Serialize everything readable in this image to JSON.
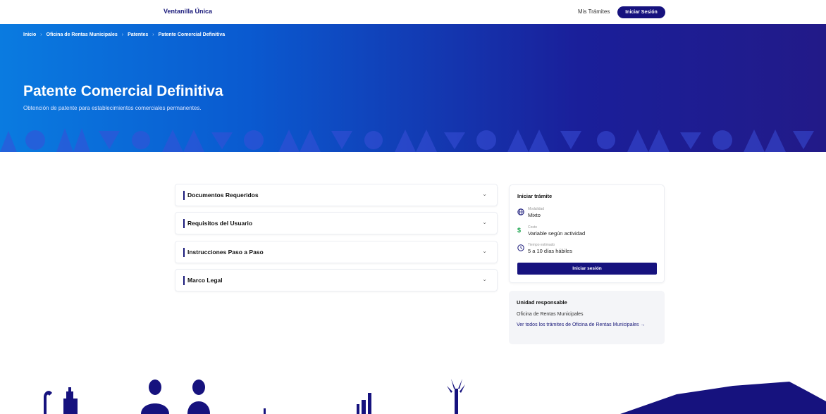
{
  "nav": {
    "brand": "Ventanilla Única",
    "my_procedures": "Mis Trámites",
    "login": "Iniciar Sesión"
  },
  "breadcrumb": [
    "Inicio",
    "Oficina de Rentas Municipales",
    "Patentes",
    "Patente Comercial Definitiva"
  ],
  "hero": {
    "title": "Patente Comercial Definitiva",
    "subtitle": "Obtención de patente para establecimientos comerciales permanentes."
  },
  "sections": [
    {
      "label": "Documentos Requeridos"
    },
    {
      "label": "Requisitos del Usuario"
    },
    {
      "label": "Instrucciones Paso a Paso"
    },
    {
      "label": "Marco Legal"
    }
  ],
  "start": {
    "title": "Iniciar trámite",
    "modality_label": "Modalidad",
    "modality_value": "Mixto",
    "cost_label": "Costo",
    "cost_value": "Variable según actividad",
    "time_label": "Tiempo estimado",
    "time_value": "5 a 10 días hábiles",
    "button": "Iniciar sesión"
  },
  "unit": {
    "title": "Unidad responsable",
    "name": "Oficina de Rentas Municipales",
    "link": "Ver todos los trámites de Oficina de Rentas Municipales →"
  },
  "colors": {
    "primary": "#16127e",
    "hero_start": "#0a7be0",
    "hero_end": "#221a88",
    "cost_icon": "#17a34a"
  },
  "icons": {
    "modality": "globe-icon",
    "cost": "dollar-icon",
    "time": "clock-icon",
    "accordion": "chevron-down-icon"
  }
}
